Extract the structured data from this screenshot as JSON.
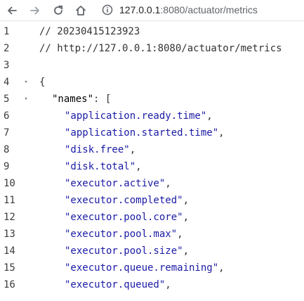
{
  "browser": {
    "url_host": "127.0.0.1",
    "url_path": ":8080/actuator/metrics",
    "icons": [
      "back-icon",
      "forward-icon",
      "reload-icon",
      "home-icon",
      "info-icon"
    ]
  },
  "viewer": {
    "colors": {
      "string": "#1a1aa6",
      "key": "#000000",
      "line_number": "#3c3c3c",
      "comment": "#333333"
    },
    "lines": [
      {
        "n": "1",
        "text": "// 20230415123923"
      },
      {
        "n": "2",
        "text": "// http://127.0.0.1:8080/actuator/metrics"
      },
      {
        "n": "3",
        "text": ""
      },
      {
        "n": "4",
        "text": "{",
        "fold": "▾"
      },
      {
        "n": "5",
        "key": "\"names\"",
        "after": ": [",
        "fold": "▾"
      },
      {
        "n": "6",
        "str": "\"application.ready.time\"",
        "after": ","
      },
      {
        "n": "7",
        "str": "\"application.started.time\"",
        "after": ","
      },
      {
        "n": "8",
        "str": "\"disk.free\"",
        "after": ","
      },
      {
        "n": "9",
        "str": "\"disk.total\"",
        "after": ","
      },
      {
        "n": "10",
        "str": "\"executor.active\"",
        "after": ","
      },
      {
        "n": "11",
        "str": "\"executor.completed\"",
        "after": ","
      },
      {
        "n": "12",
        "str": "\"executor.pool.core\"",
        "after": ","
      },
      {
        "n": "13",
        "str": "\"executor.pool.max\"",
        "after": ","
      },
      {
        "n": "14",
        "str": "\"executor.pool.size\"",
        "after": ","
      },
      {
        "n": "15",
        "str": "\"executor.queue.remaining\"",
        "after": ","
      },
      {
        "n": "16",
        "str": "\"executor.queued\"",
        "after": ","
      }
    ]
  }
}
